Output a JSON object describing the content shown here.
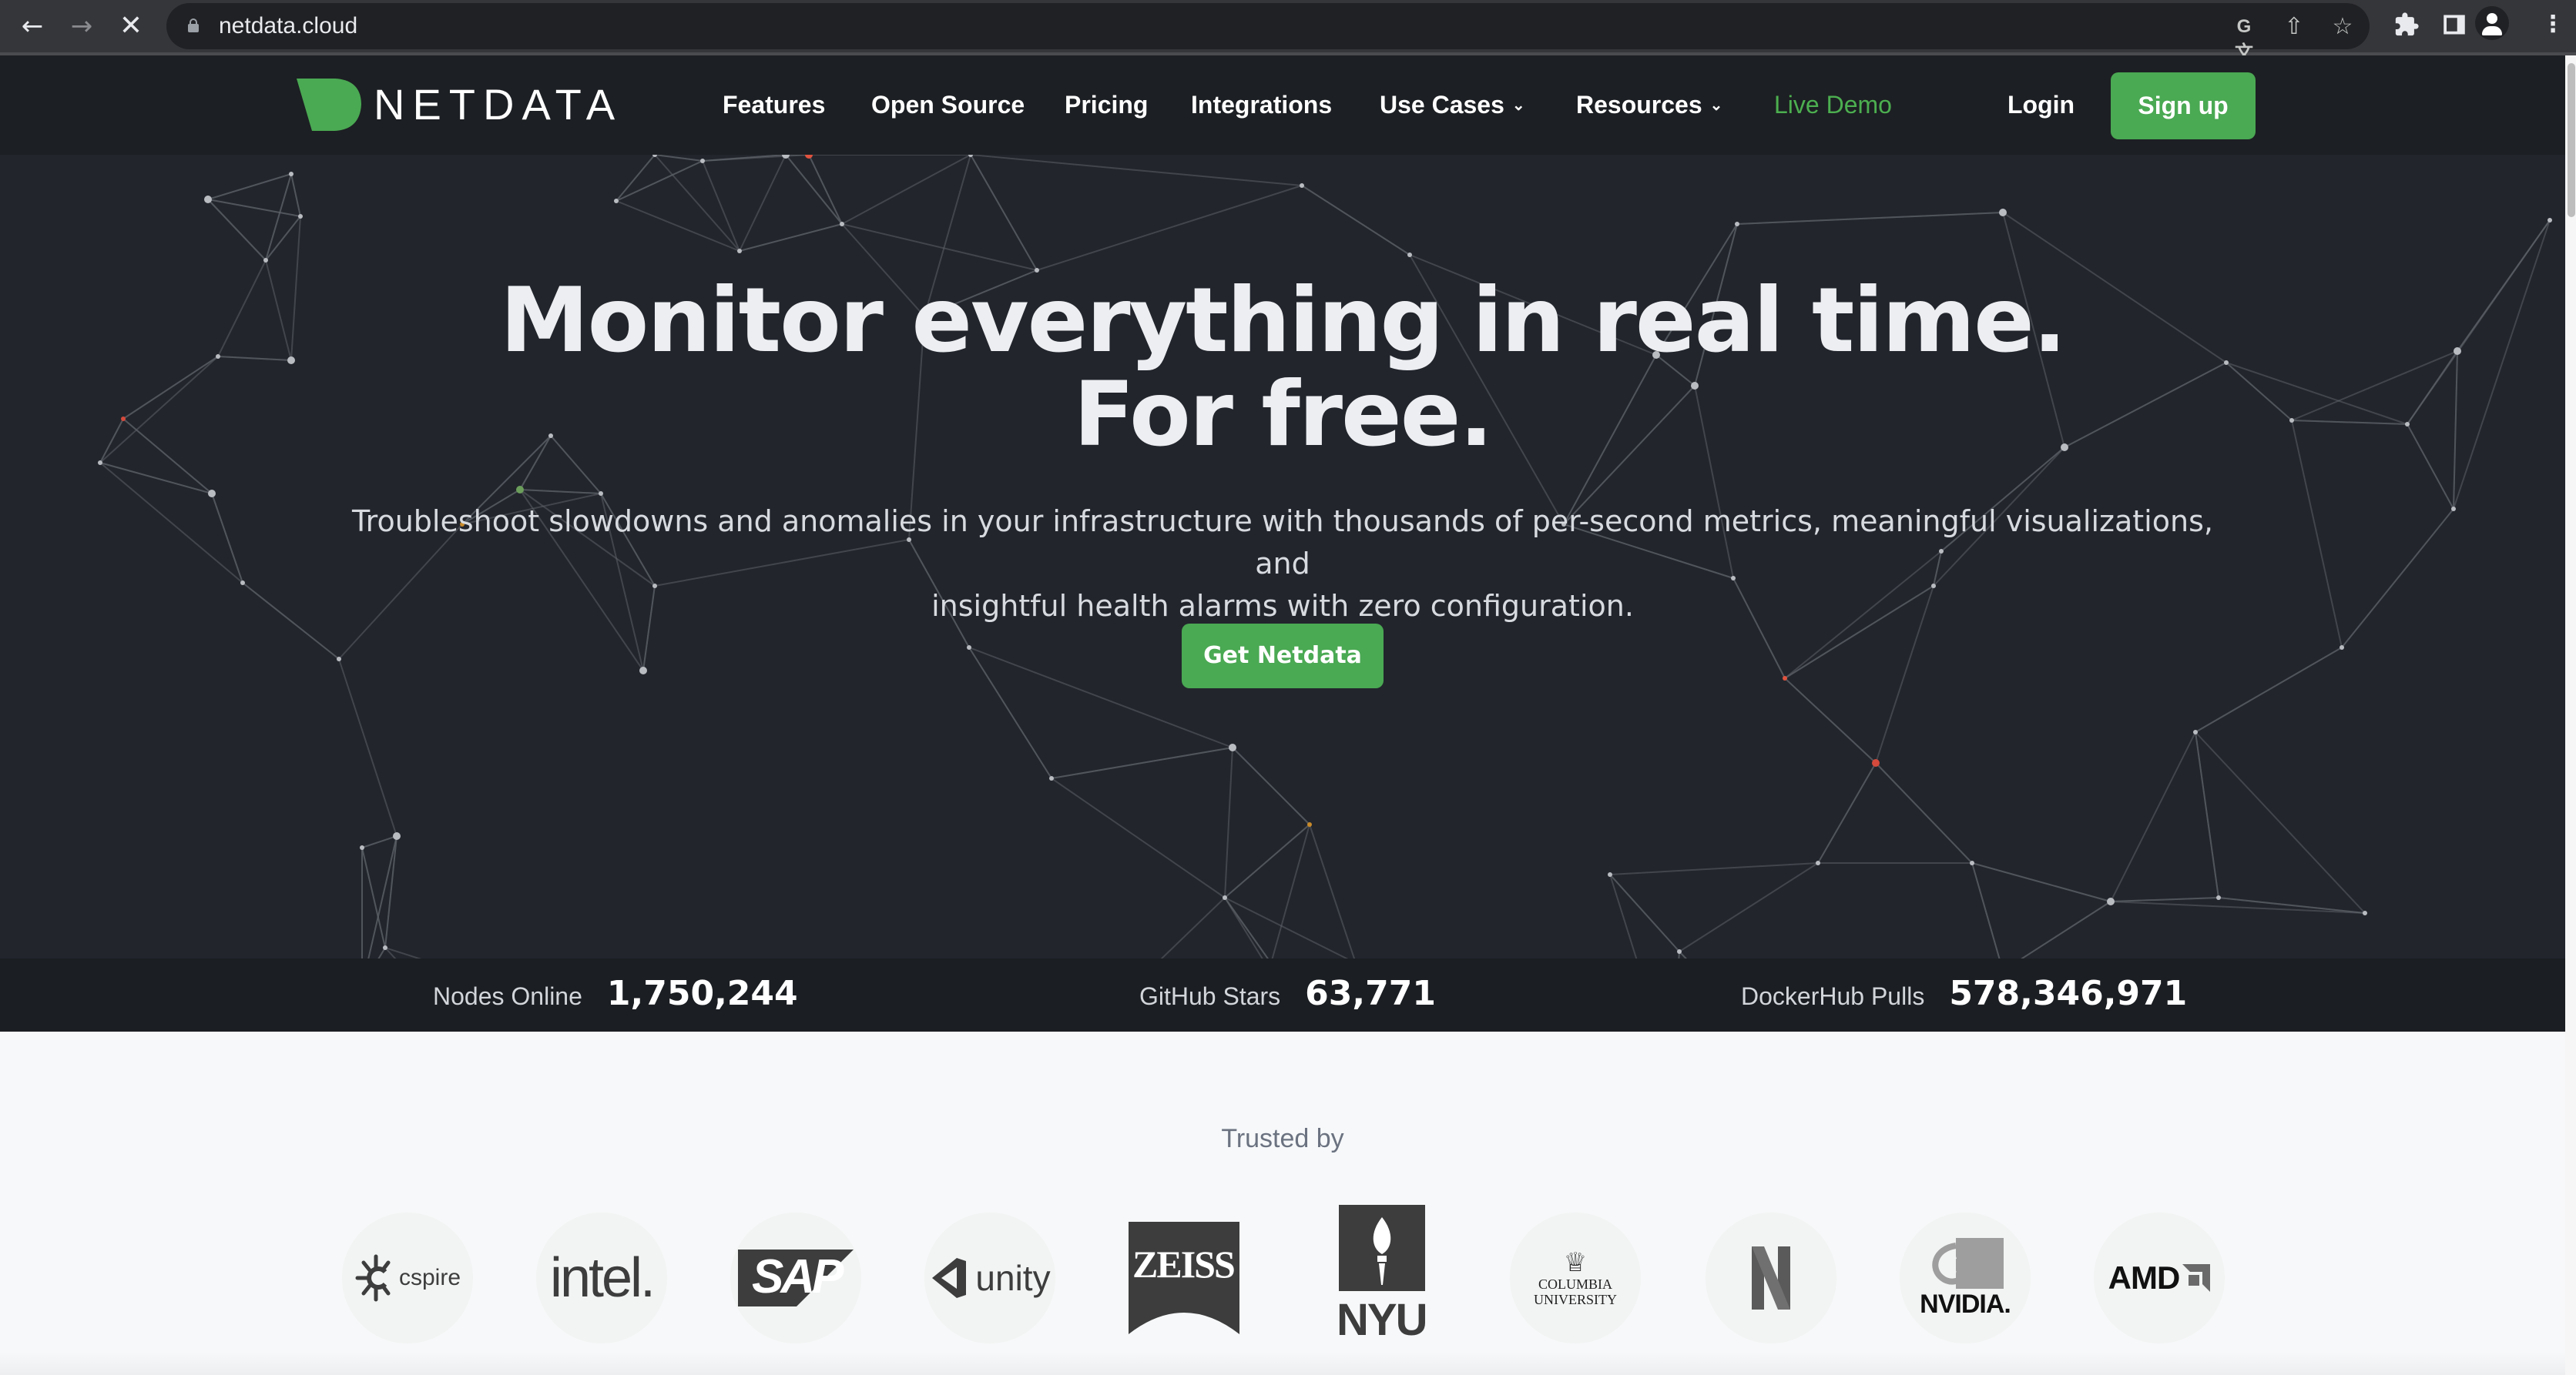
{
  "browser": {
    "url": "netdata.cloud",
    "icons": {
      "back": "back-arrow-icon",
      "forward": "forward-arrow-icon",
      "stop": "stop-loading-icon",
      "lock": "lock-icon",
      "translate": "translate-icon",
      "share": "share-icon",
      "bookmark": "bookmark-star-icon",
      "extensions": "extensions-puzzle-icon",
      "side_panel": "side-panel-icon",
      "profile": "profile-avatar-icon",
      "menu": "kebab-menu-icon"
    }
  },
  "header": {
    "logo_text": "NETDATA",
    "brand_color": "#4aa953",
    "nav": [
      {
        "label": "Features",
        "dropdown": false
      },
      {
        "label": "Open Source",
        "dropdown": false
      },
      {
        "label": "Pricing",
        "dropdown": false
      },
      {
        "label": "Integrations",
        "dropdown": false
      },
      {
        "label": "Use Cases",
        "dropdown": true
      },
      {
        "label": "Resources",
        "dropdown": true
      },
      {
        "label": "Live Demo",
        "dropdown": false,
        "highlight": true
      }
    ],
    "login_label": "Login",
    "signup_label": "Sign up"
  },
  "hero": {
    "title_line1": "Monitor everything in real time.",
    "title_line2": "For free.",
    "subtitle_line1": "Troubleshoot slowdowns and anomalies in your infrastructure with thousands of per-second metrics, meaningful visualizations, and",
    "subtitle_line2": "insightful health alarms with zero configuration.",
    "cta_label": "Get Netdata"
  },
  "stats": [
    {
      "label": "Nodes Online",
      "value": "1,750,244"
    },
    {
      "label": "GitHub Stars",
      "value": "63,771"
    },
    {
      "label": "DockerHub Pulls",
      "value": "578,346,971"
    }
  ],
  "trusted": {
    "title": "Trusted by",
    "logos": [
      {
        "name": "C Spire",
        "text": "cspire"
      },
      {
        "name": "Intel",
        "text": "intel."
      },
      {
        "name": "SAP",
        "text": "SAP"
      },
      {
        "name": "Unity",
        "text": "unity"
      },
      {
        "name": "Zeiss",
        "text": "ZEISS"
      },
      {
        "name": "NYU",
        "text": "NYU"
      },
      {
        "name": "Columbia University",
        "text_line1": "COLUMBIA",
        "text_line2": "UNIVERSITY"
      },
      {
        "name": "Netflix",
        "text": "N"
      },
      {
        "name": "NVIDIA",
        "text": "NVIDIA."
      },
      {
        "name": "AMD",
        "text": "AMD"
      }
    ]
  }
}
